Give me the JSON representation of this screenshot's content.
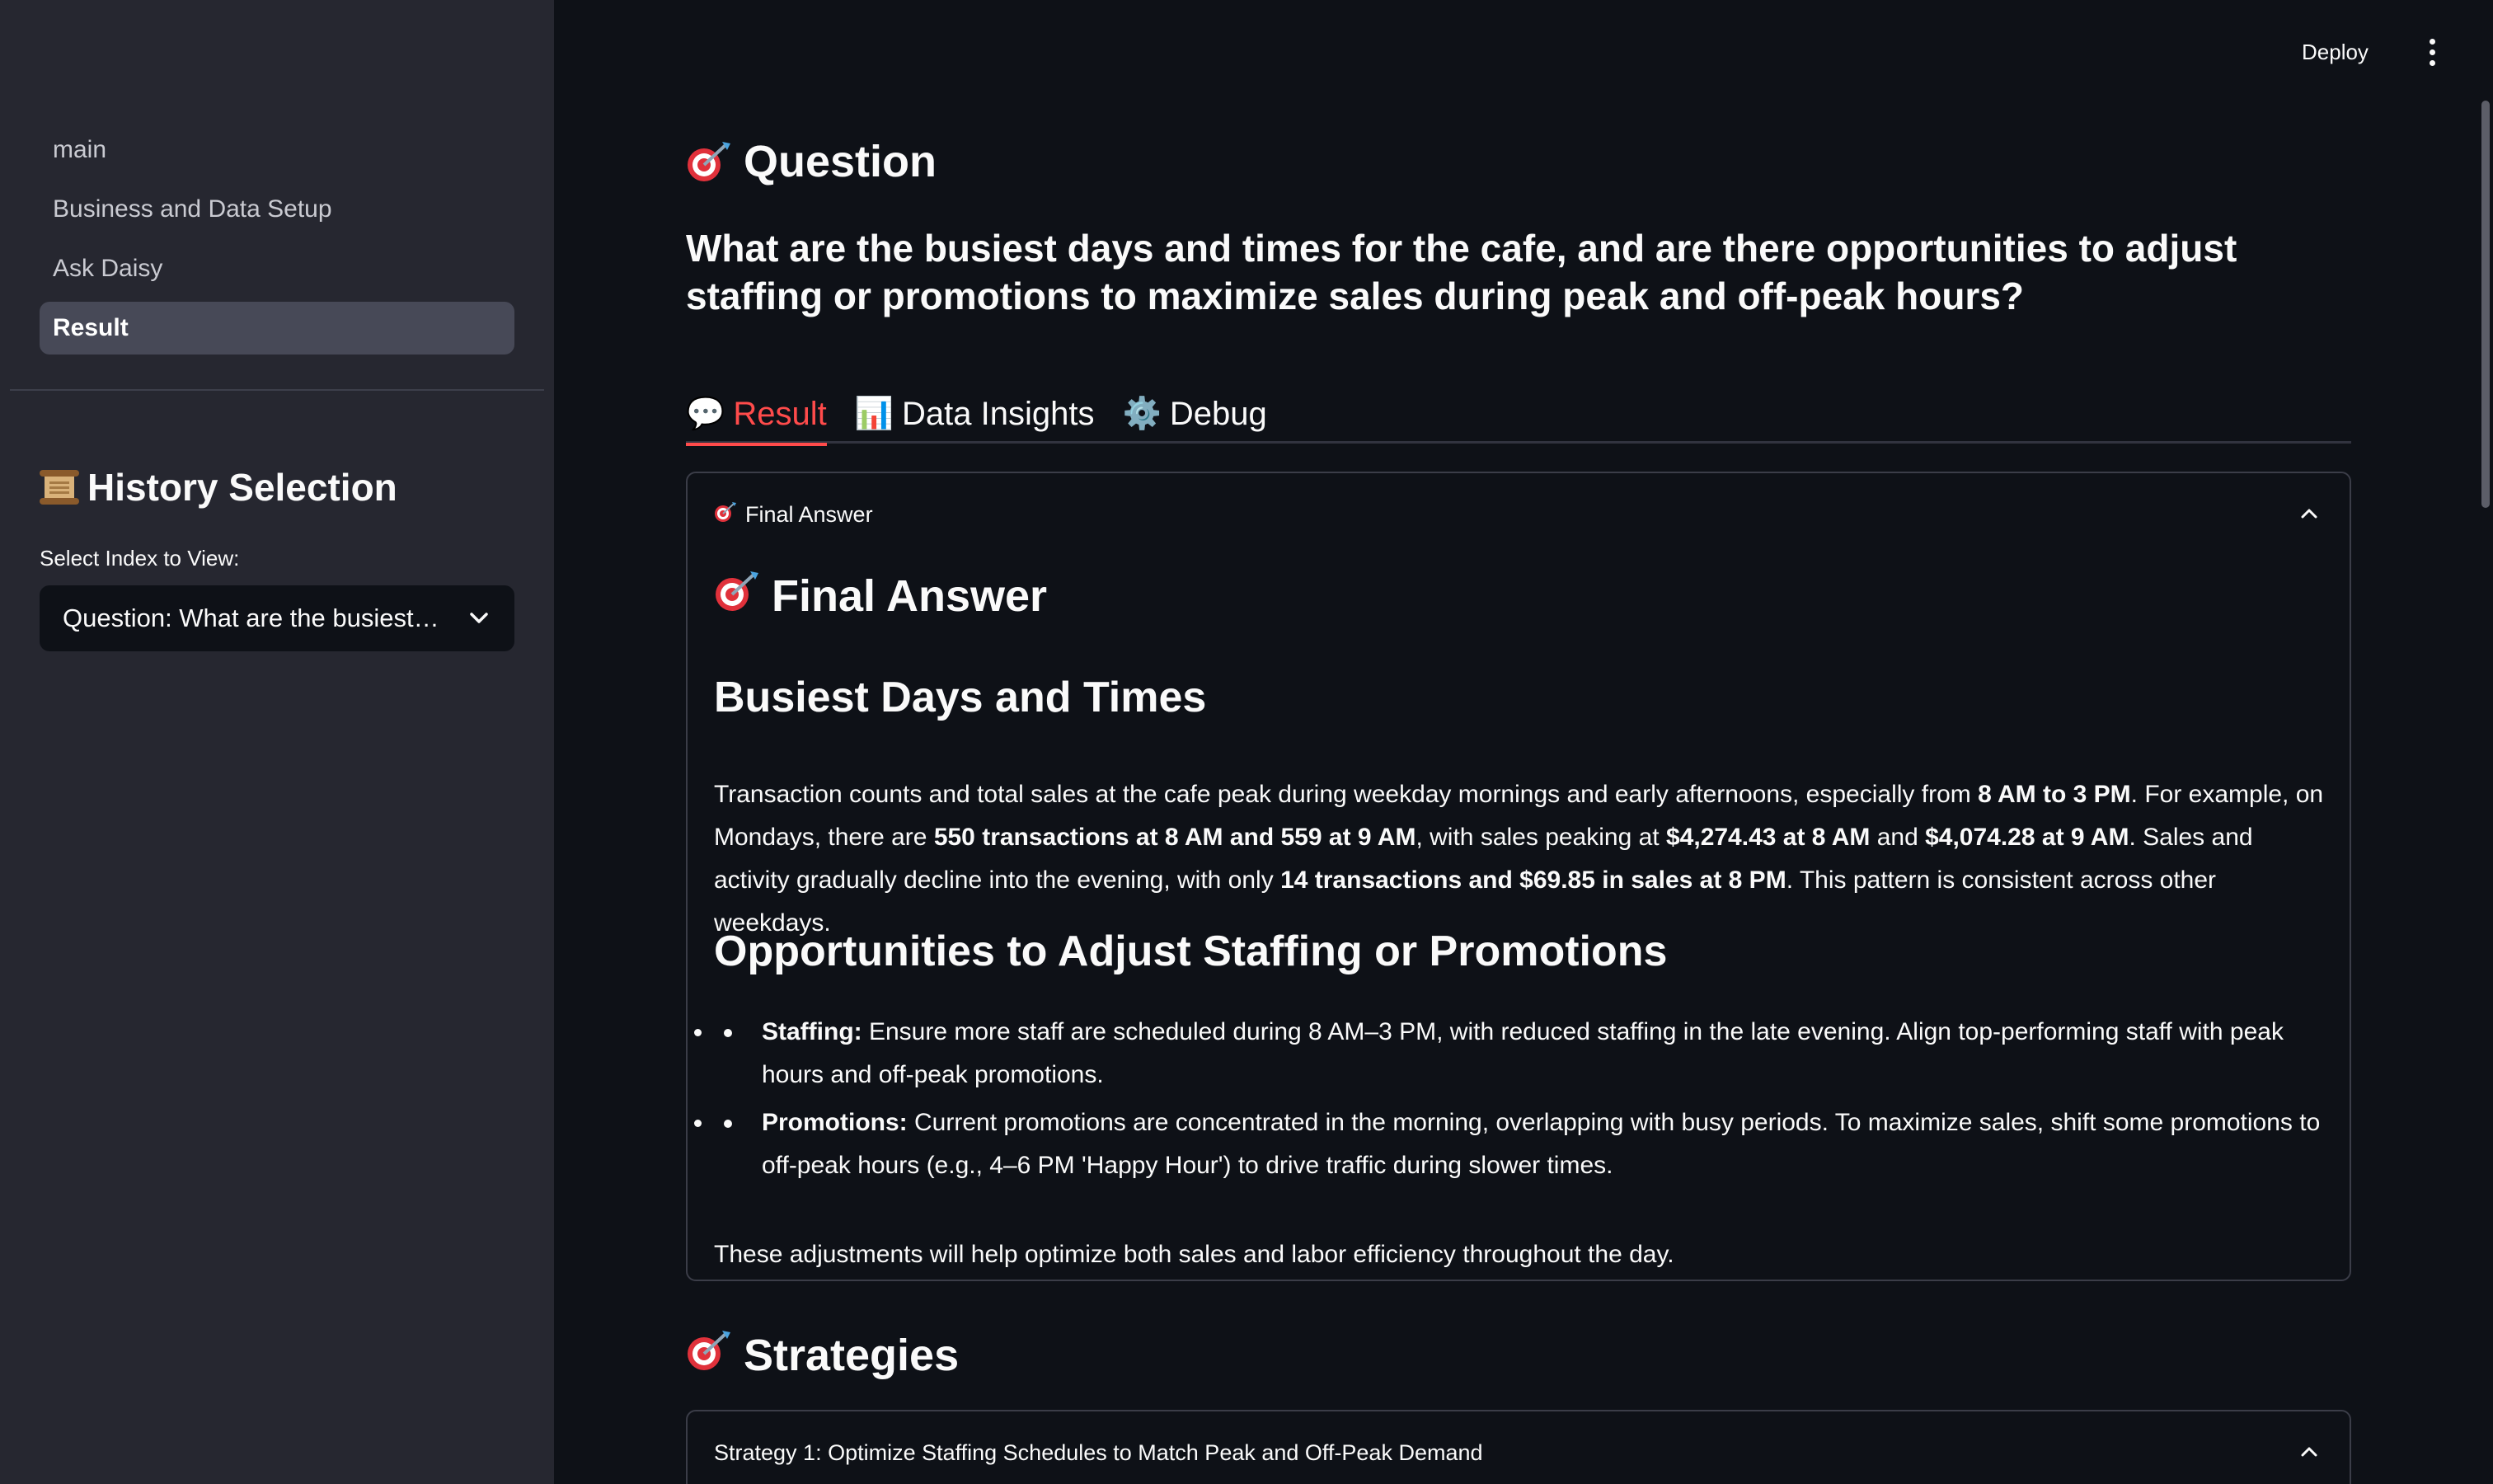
{
  "sidebar": {
    "nav": [
      "main",
      "Business and Data Setup",
      "Ask Daisy",
      "Result"
    ],
    "active_index": 3,
    "history_title": "History Selection",
    "history_icon": "scroll-icon",
    "select_label": "Select Index to View:",
    "select_value": "Question: What are the busiest days and times for the cafe, and are there opportunities to adjust staffing or promotions to maximize sales during peak and off-peak hours?"
  },
  "header": {
    "deploy": "Deploy",
    "menu_icon": "vertical-ellipsis-icon"
  },
  "main": {
    "question_heading": "Question",
    "question_text": "What are the busiest days and times for the cafe, and are there opportunities to adjust staffing or promotions to maximize sales during peak and off-peak hours?",
    "tabs": [
      {
        "icon": "💬",
        "label": "Result"
      },
      {
        "icon": "📊",
        "label": "Data Insights"
      },
      {
        "icon": "⚙️",
        "label": "Debug"
      }
    ],
    "active_tab": 0,
    "final_answer_expander": "Final Answer",
    "final_answer_heading": "Final Answer",
    "busiest_heading": "Busiest Days and Times",
    "busiest_para": {
      "t1": "Transaction counts and total sales at the cafe peak during weekday mornings and early afternoons, especially from ",
      "b1": "8 AM to 3 PM",
      "t2": ". For example, on Mondays, there are ",
      "b2": "550 transactions at 8 AM and 559 at 9 AM",
      "t3": ", with sales peaking at ",
      "b3": "$4,274.43 at 8 AM",
      "t4": " and ",
      "b4": "$4,074.28 at 9 AM",
      "t5": ". Sales and activity gradually decline into the evening, with only ",
      "b5": "14 transactions and $69.85 in sales at 8 PM",
      "t6": ". This pattern is consistent across other weekdays."
    },
    "opportunities_heading": "Opportunities to Adjust Staffing or Promotions",
    "bullets": [
      {
        "label": "Staffing:",
        "text": " Ensure more staff are scheduled during 8 AM–3 PM, with reduced staffing in the late evening. Align top-performing staff with peak hours and off-peak promotions."
      },
      {
        "label": "Promotions:",
        "text": " Current promotions are concentrated in the morning, overlapping with busy periods. To maximize sales, shift some promotions to off-peak hours (e.g., 4–6 PM 'Happy Hour') to drive traffic during slower times."
      }
    ],
    "closing": "These adjustments will help optimize both sales and labor efficiency throughout the day.",
    "strategies_heading": "Strategies",
    "strategy1": "Strategy 1: Optimize Staffing Schedules to Match Peak and Off-Peak Demand"
  },
  "colors": {
    "accent": "#ff4b4b",
    "sidebar_bg": "#262730",
    "main_bg": "#0e1117"
  }
}
